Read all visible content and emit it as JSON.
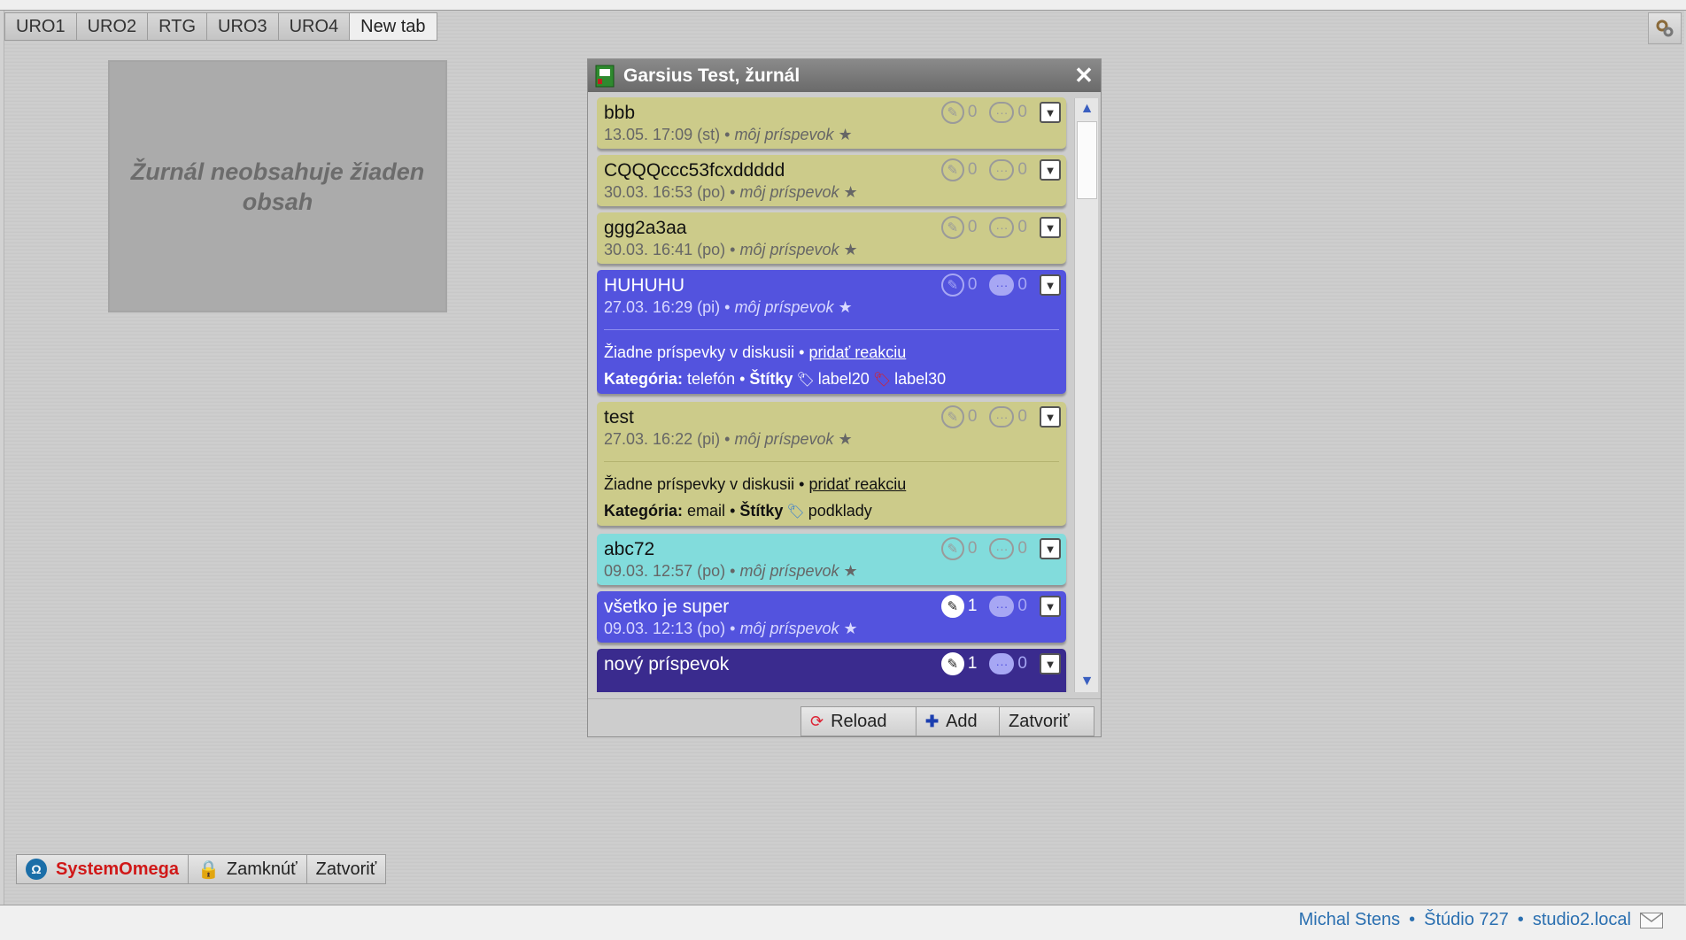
{
  "tabs": [
    "URO1",
    "URO2",
    "RTG",
    "URO3",
    "URO4",
    "New tab"
  ],
  "active_tab": "New tab",
  "empty_panel": {
    "message": "Žurnál neobsahuje žiaden obsah"
  },
  "window": {
    "title": "Garsius Test, žurnál",
    "close_glyph": "✕",
    "items": [
      {
        "title": "bbb",
        "date": "13.05. 17:09 (st)",
        "author": "môj príspevok",
        "star": "★",
        "attachments": "0",
        "comments": "0",
        "color": "olive"
      },
      {
        "title": "CQQQccc53fcxddddd",
        "date": "30.03. 16:53 (po)",
        "author": "môj príspevok",
        "star": "★",
        "attachments": "0",
        "comments": "0",
        "color": "olive"
      },
      {
        "title": "ggg2a3aa",
        "date": "30.03. 16:41 (po)",
        "author": "môj príspevok",
        "star": "★",
        "attachments": "0",
        "comments": "0",
        "color": "olive"
      },
      {
        "title": "HUHUHU",
        "date": "27.03. 16:29 (pi)",
        "author": "môj príspevok",
        "star": "★",
        "attachments": "0",
        "comments": "0",
        "color": "blue",
        "discussion": "Žiadne príspevky v diskusii",
        "add_reaction": "pridať reakciu",
        "category_label": "Kategória:",
        "category": "telefón",
        "tags_label": "Štítky",
        "tags": [
          "label20",
          "label30"
        ]
      },
      {
        "title": "test",
        "date": "27.03. 16:22 (pi)",
        "author": "môj príspevok",
        "star": "★",
        "attachments": "0",
        "comments": "0",
        "color": "olive",
        "discussion": "Žiadne príspevky v diskusii",
        "add_reaction": "pridať reakciu",
        "category_label": "Kategória:",
        "category": "email",
        "tags_label": "Štítky",
        "tags": [
          "podklady"
        ]
      },
      {
        "title": "abc72",
        "date": "09.03. 12:57 (po)",
        "author": "môj príspevok",
        "star": "★",
        "attachments": "0",
        "comments": "0",
        "color": "cyan"
      },
      {
        "title": "všetko je super",
        "date": "09.03. 12:13 (po)",
        "author": "môj príspevok",
        "star": "★",
        "attachments": "1",
        "comments": "0",
        "color": "blue"
      },
      {
        "title": "nový príspevok",
        "attachments": "1",
        "comments": "0",
        "color": "navy"
      }
    ],
    "separator": "•",
    "footer": {
      "reload": "Reload",
      "add": "Add",
      "close": "Zatvoriť"
    }
  },
  "bottom_bar": {
    "brand": "SystemOmega",
    "lock": "Zamknúť",
    "close": "Zatvoriť"
  },
  "status": {
    "user": "Michal Stens",
    "studio": "Štúdio 727",
    "host": "studio2.local",
    "separator": "•"
  },
  "colors": {
    "olive": "#cccb8a",
    "blue": "#5353de",
    "cyan": "#82dcdc",
    "navy": "#3a2b8e",
    "status_text": "#2a6fb0",
    "brand": "#d01818"
  }
}
